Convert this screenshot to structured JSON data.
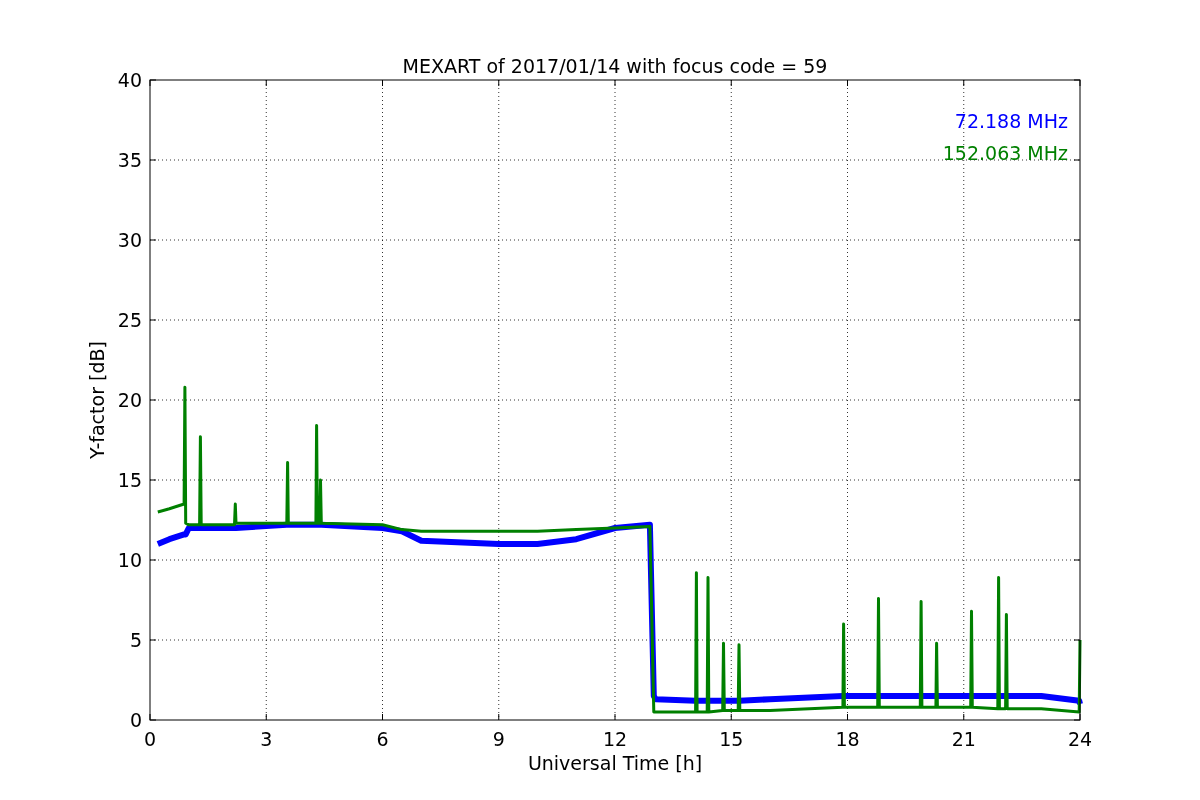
{
  "chart_data": {
    "type": "line",
    "title": "MEXART of 2017/01/14 with focus code = 59",
    "xlabel": "Universal Time [h]",
    "ylabel": "Y-factor [dB]",
    "x": [
      0.2,
      0.5,
      0.88,
      0.9,
      0.92,
      1.0,
      1.28,
      1.3,
      1.32,
      2.18,
      2.2,
      2.22,
      3.53,
      3.55,
      3.57,
      4.28,
      4.3,
      4.32,
      4.38,
      4.4,
      4.42,
      6,
      6.5,
      7,
      9,
      10,
      11,
      12,
      12.9,
      13,
      13.05,
      14.08,
      14.1,
      14.12,
      14.38,
      14.4,
      14.42,
      14.78,
      14.8,
      14.82,
      15.18,
      15.2,
      15.22,
      16,
      17.88,
      17.9,
      17.92,
      18.78,
      18.8,
      18.82,
      19.88,
      19.9,
      19.92,
      20.28,
      20.3,
      20.32,
      21.18,
      21.2,
      21.22,
      21.88,
      21.9,
      21.92,
      22.08,
      22.1,
      22.12,
      23,
      23.98,
      24
    ],
    "series": [
      {
        "name": "72.188 MHz",
        "color": "#0000ff",
        "values": [
          11,
          11.3,
          11.6,
          11.6,
          11.6,
          12,
          12,
          12,
          12,
          12,
          12,
          12,
          12.2,
          12.2,
          12.2,
          12.2,
          12.2,
          12.2,
          12.2,
          12.2,
          12.2,
          12,
          11.8,
          11.2,
          11,
          11,
          11.3,
          12,
          12.2,
          1.5,
          1.3,
          1.2,
          1.2,
          1.2,
          1.2,
          1.2,
          1.2,
          1.2,
          1.2,
          1.2,
          1.2,
          1.2,
          1.2,
          1.3,
          1.5,
          1.5,
          1.5,
          1.5,
          1.5,
          1.5,
          1.5,
          1.5,
          1.5,
          1.5,
          1.5,
          1.5,
          1.5,
          1.5,
          1.5,
          1.5,
          1.5,
          1.5,
          1.5,
          1.5,
          1.5,
          1.5,
          1.2,
          1.0
        ]
      },
      {
        "name": "152.063 MHz",
        "color": "#008000",
        "values": [
          13,
          13.2,
          13.5,
          20.8,
          12.3,
          12.2,
          12.2,
          17.7,
          12.2,
          12.2,
          13.5,
          12.3,
          12.3,
          16.1,
          12.3,
          12.3,
          18.4,
          12.3,
          12.3,
          15,
          12.3,
          12.2,
          11.9,
          11.8,
          11.8,
          11.8,
          11.9,
          12,
          12.1,
          0.5,
          0.5,
          0.5,
          9.2,
          0.5,
          0.5,
          8.9,
          0.5,
          0.6,
          4.8,
          0.6,
          0.6,
          4.7,
          0.6,
          0.6,
          0.8,
          6,
          0.8,
          0.8,
          7.6,
          0.8,
          0.8,
          7.4,
          0.8,
          0.8,
          4.8,
          0.8,
          0.8,
          6.8,
          0.8,
          0.7,
          8.9,
          0.7,
          0.7,
          6.6,
          0.7,
          0.7,
          0.5,
          5
        ]
      }
    ],
    "grid": true,
    "xlim": [
      0,
      24
    ],
    "ylim": [
      0,
      40
    ],
    "xticks": [
      0,
      3,
      6,
      9,
      12,
      15,
      18,
      21,
      24
    ],
    "yticks": [
      0,
      5,
      10,
      15,
      20,
      25,
      30,
      35,
      40
    ]
  }
}
